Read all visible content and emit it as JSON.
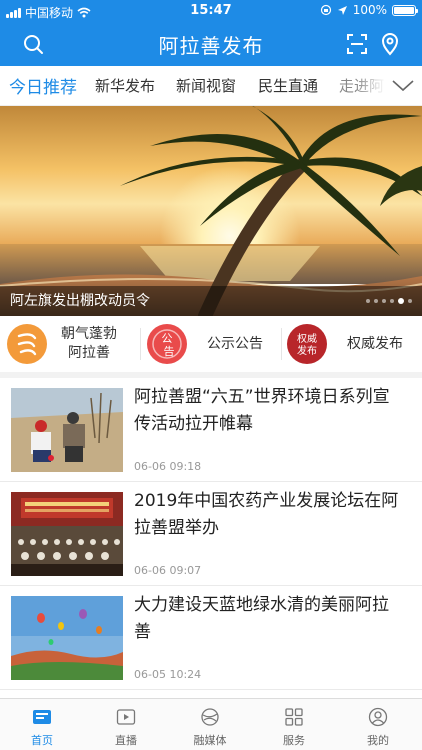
{
  "status_bar": {
    "carrier": "中国移动",
    "time": "15:47",
    "battery": "100%"
  },
  "header": {
    "title": "阿拉善发布",
    "left_icon": "search-icon",
    "right_icons": [
      "scan-icon",
      "location-icon"
    ],
    "color": "#1e8be6"
  },
  "tabs": {
    "items": [
      {
        "label": "今日推荐",
        "active": true
      },
      {
        "label": "新华发布"
      },
      {
        "label": "新闻视窗"
      },
      {
        "label": "民生直通"
      },
      {
        "label": "走进阿"
      }
    ],
    "more_icon": "chevron-down-icon"
  },
  "banner": {
    "caption": "阿左旗发出棚改动员令",
    "slide_count": 6,
    "active_slide": 5
  },
  "channels": [
    {
      "label_line1": "朝气蓬勃",
      "label_line2": "阿拉善",
      "icon": "zhaoqi-logo-icon",
      "color": "#f39a3a"
    },
    {
      "label_line1": "公示公告",
      "label_line2": "",
      "icon": "gonggao-logo-icon",
      "color": "#e94b4b"
    },
    {
      "label_line1": "权威发布",
      "label_line2": "",
      "icon": "quanwei-logo-icon",
      "color": "#b8262a"
    }
  ],
  "news": [
    {
      "title": "阿拉善盟“六五”世界环境日系列宣传活动拉开帷幕",
      "time": "06-06 09:18"
    },
    {
      "title": "2019年中国农药产业发展论坛在阿拉善盟举办",
      "time": "06-06 09:07"
    },
    {
      "title": "大力建设天蓝地绿水清的美丽阿拉善",
      "time": "06-05 10:24"
    }
  ],
  "bottom_nav": [
    {
      "label": "首页",
      "icon": "home-icon",
      "active": true
    },
    {
      "label": "直播",
      "icon": "live-play-icon"
    },
    {
      "label": "融媒体",
      "icon": "media-icon"
    },
    {
      "label": "服务",
      "icon": "services-grid-icon"
    },
    {
      "label": "我的",
      "icon": "profile-icon"
    }
  ]
}
